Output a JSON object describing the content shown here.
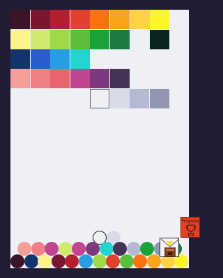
{
  "palette": {
    "row1": [
      "#3b1427",
      "#7b1631",
      "#b41f30",
      "#e2412b",
      "#f9720e",
      "#f9a51c",
      "#ffd145",
      "#fbf52b"
    ],
    "row2": [
      "#fcf38d",
      "#d1ea6d",
      "#9ed84b",
      "#5cbe3c",
      "#1aa33a",
      "#1c7a43",
      "",
      "#0d2521"
    ],
    "row3": [
      "#13356b",
      "#2d5dcc",
      "#279ee3",
      "#21d6d0"
    ],
    "row4": [
      "#f29e99",
      "#ef8086",
      "#e8646f",
      "#c0468f",
      "#7c3a7e",
      "#453256"
    ],
    "row5": [
      "",
      "#d8dbe8",
      "#b5b9d1",
      "#9095b0"
    ]
  },
  "tray": {
    "back_row": [
      {
        "style": "outline",
        "color": ""
      },
      {
        "style": "fill",
        "color": "#d8dbe8"
      }
    ],
    "middle_row": [
      "#f29e99",
      "#ef8086",
      "#c0468f",
      "#d1ea6d",
      "#c0468f",
      "#7c3a7e",
      "#21d6d0",
      "#453256",
      "#b5b9d1",
      "#1aa33a",
      "#9095b0",
      "#1c7a43"
    ],
    "front_row": [
      "#3b1427",
      "#13356b",
      "#fcf38d",
      "#7b1631",
      "#b41f30",
      "#279ee3",
      "#9ed84b",
      "#e2412b",
      "#5cbe3c",
      "#f9720e",
      "#f9a51c",
      "#ffd145",
      "#fbf52b"
    ]
  },
  "progress_button": {
    "label": "Progress",
    "color": "#e5401e",
    "icon": "trophy-icon"
  },
  "machine": {
    "icon": "color-mixer-machine-icon",
    "accent": "#f7e22a",
    "base": "#7a3e1d"
  }
}
